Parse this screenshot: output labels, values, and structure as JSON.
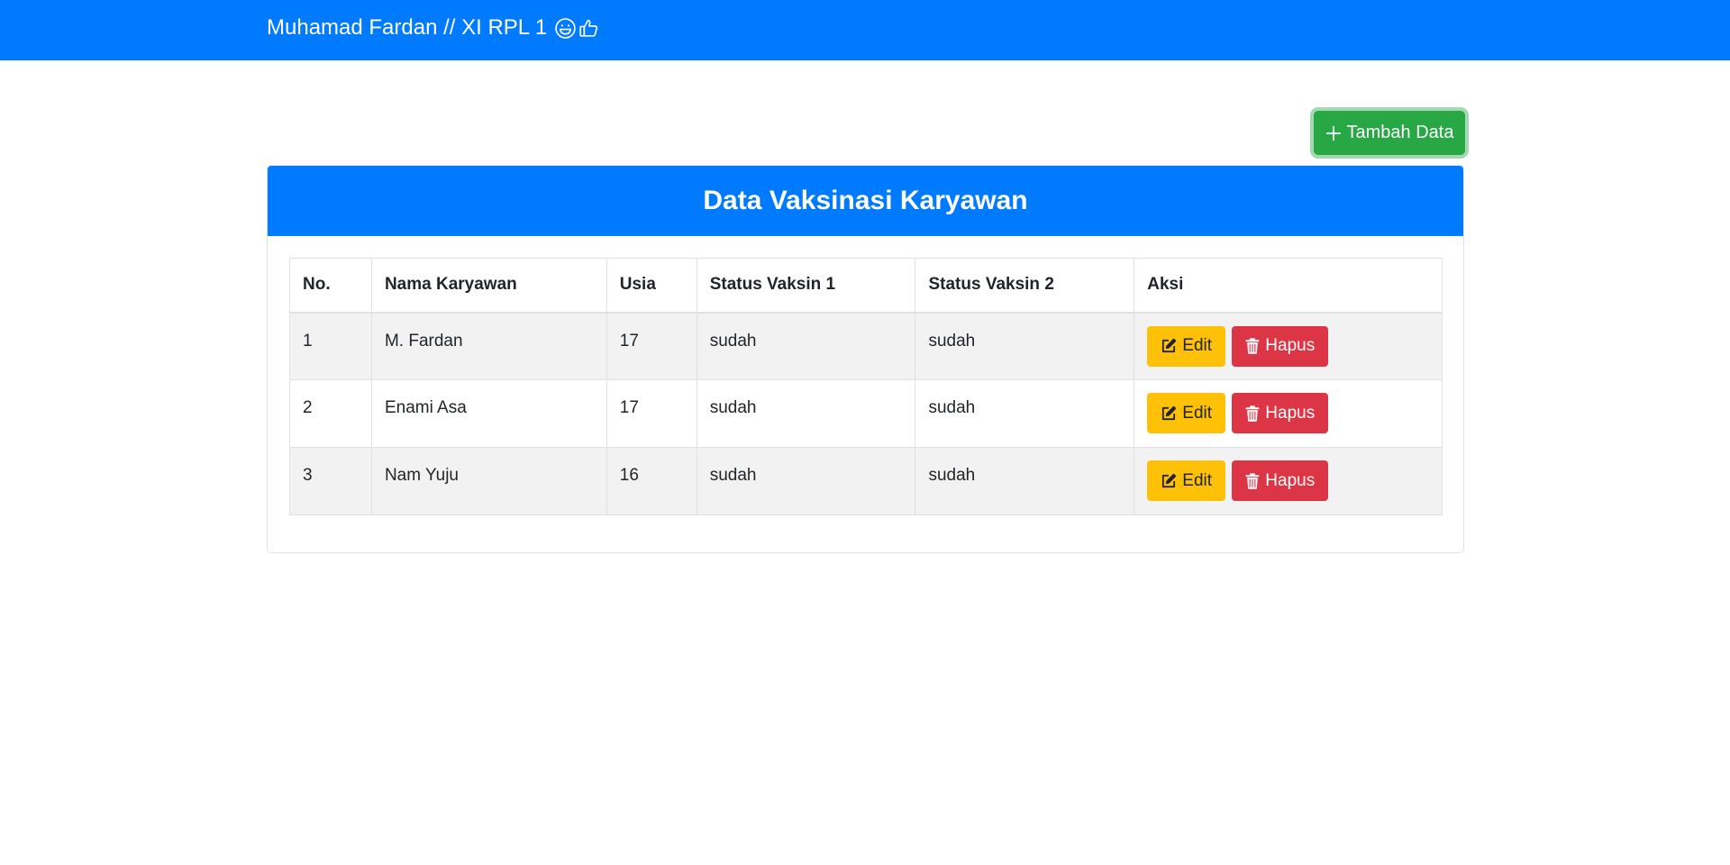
{
  "navbar": {
    "brand": "Muhamad Fardan // XI RPL 1",
    "emoji_icons": [
      "grinning-face-icon",
      "thumbs-up-icon"
    ]
  },
  "actions": {
    "add_label": "Tambah Data",
    "add_icon": "plus-icon"
  },
  "card": {
    "title": "Data Vaksinasi Karyawan"
  },
  "table": {
    "columns": [
      "No.",
      "Nama Karyawan",
      "Usia",
      "Status Vaksin 1",
      "Status Vaksin 2",
      "Aksi"
    ],
    "rows": [
      {
        "no": "1",
        "nama": "M. Fardan",
        "usia": "17",
        "vaksin1": "sudah",
        "vaksin2": "sudah"
      },
      {
        "no": "2",
        "nama": "Enami Asa",
        "usia": "17",
        "vaksin1": "sudah",
        "vaksin2": "sudah"
      },
      {
        "no": "3",
        "nama": "Nam Yuju",
        "usia": "16",
        "vaksin1": "sudah",
        "vaksin2": "sudah"
      }
    ],
    "edit_label": "Edit",
    "edit_icon": "edit-icon",
    "delete_label": "Hapus",
    "delete_icon": "trash-icon"
  },
  "colors": {
    "primary": "#007bff",
    "success": "#28a745",
    "warning": "#ffc107",
    "danger": "#dc3545",
    "stripe": "#f2f2f2"
  }
}
